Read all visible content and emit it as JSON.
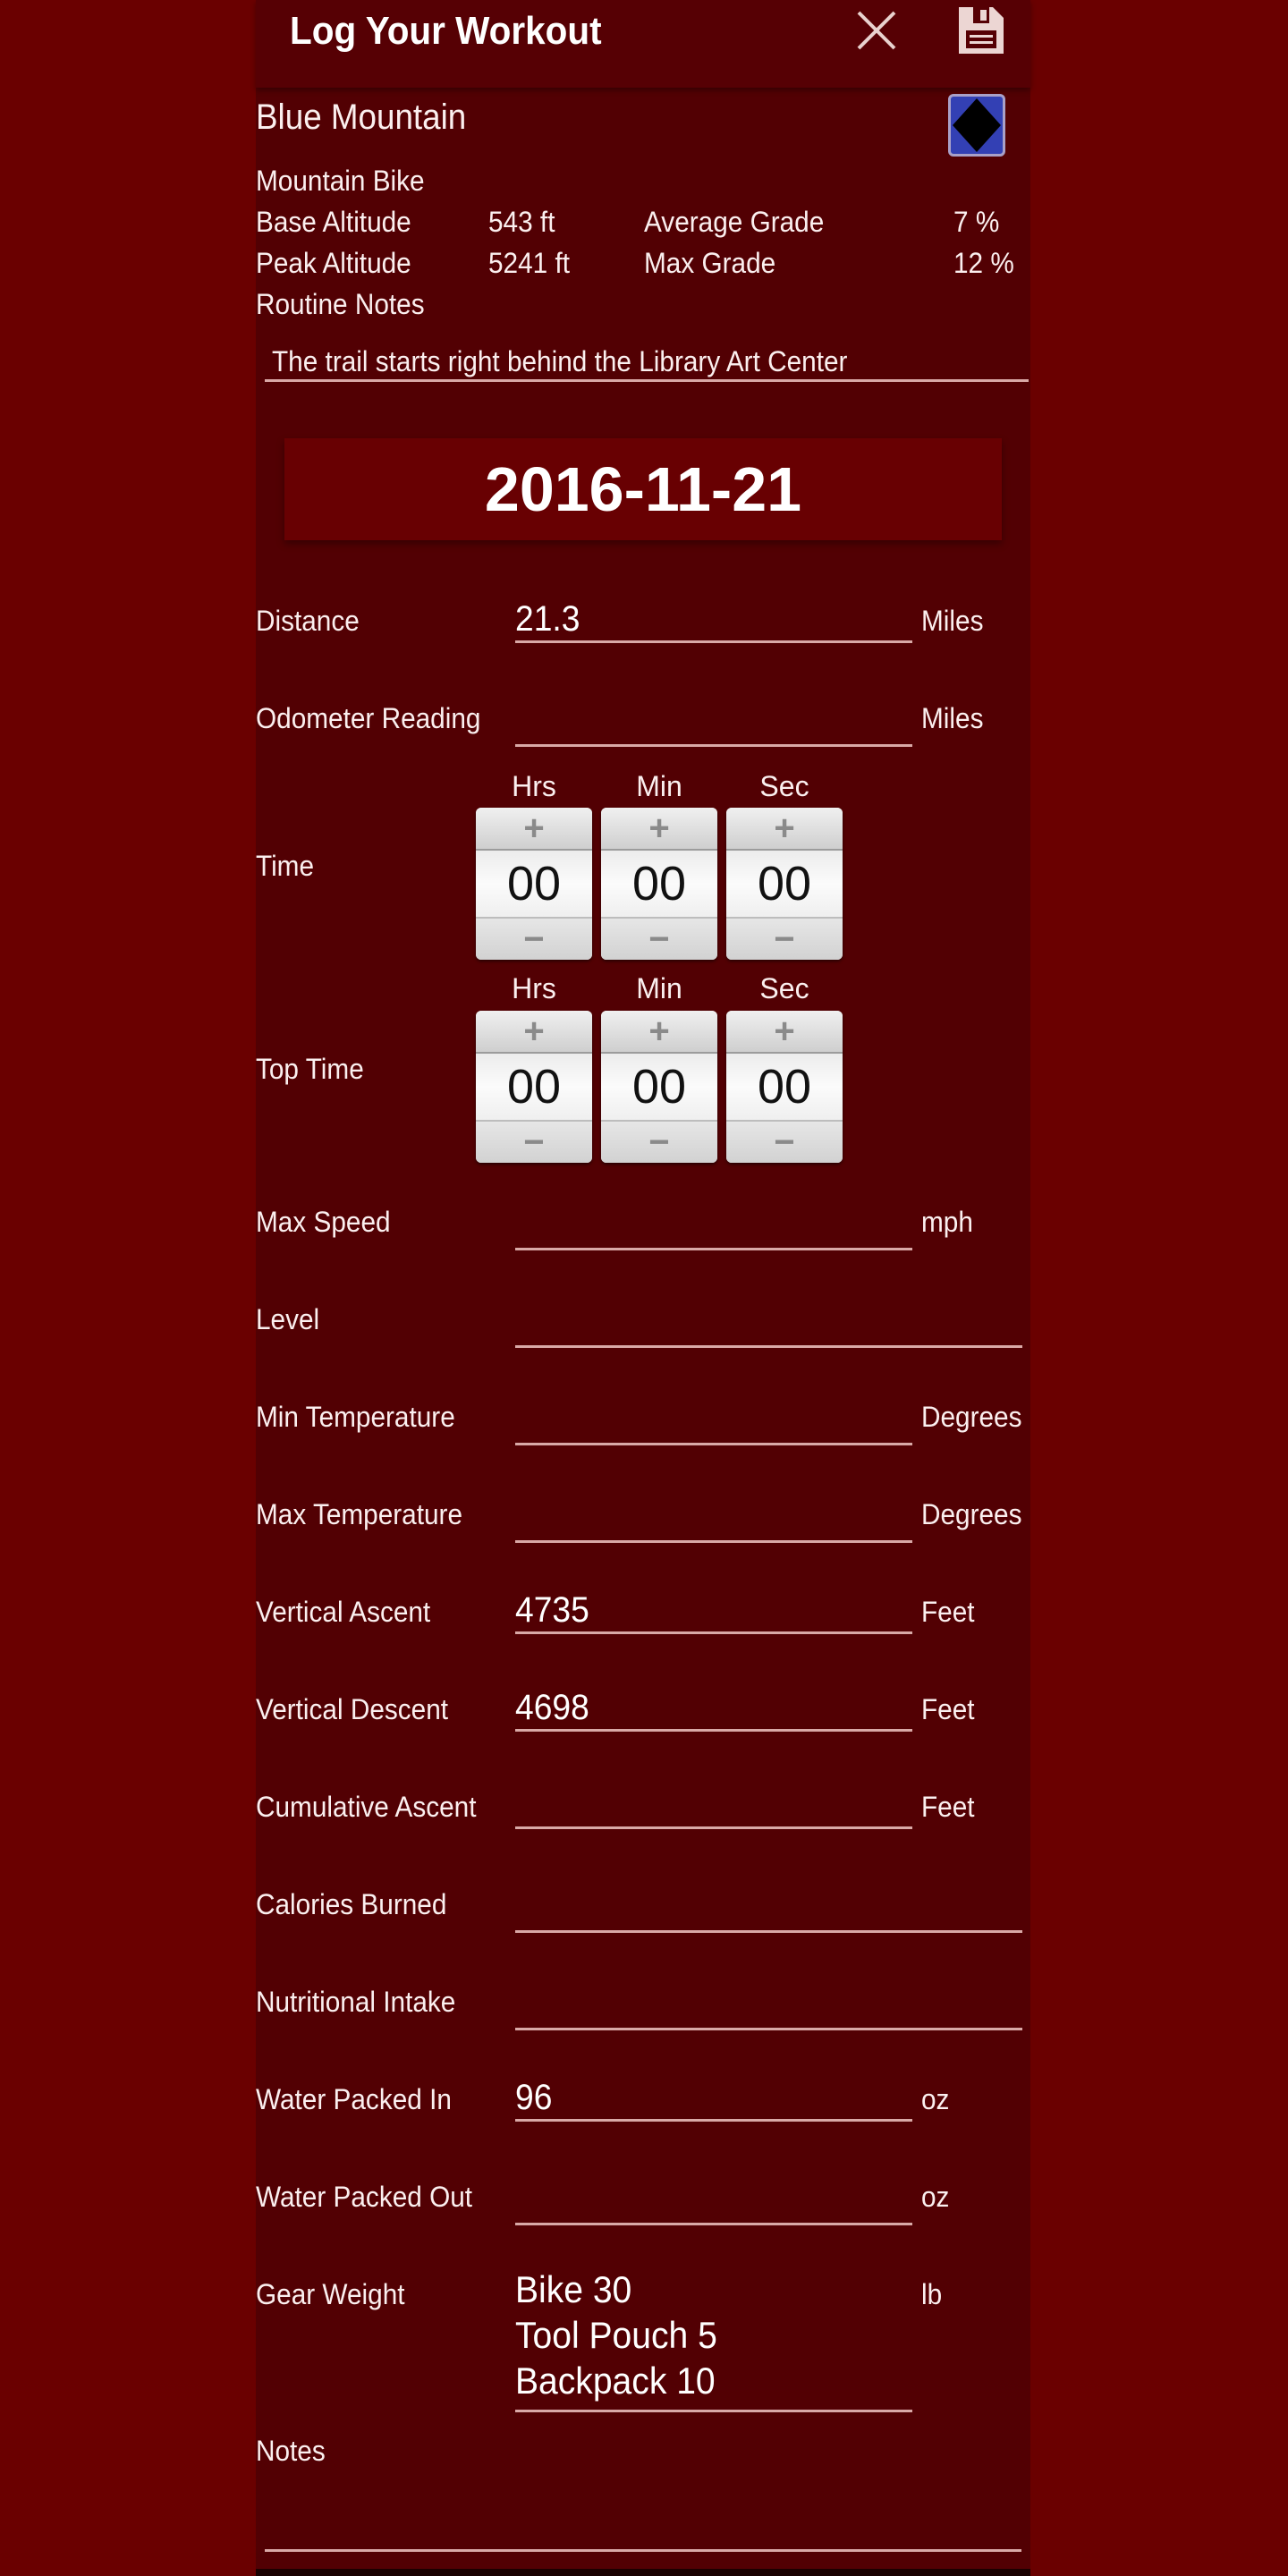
{
  "header": {
    "title": "Log Your Workout",
    "close_icon": "close-icon",
    "save_icon": "save-floppy-icon"
  },
  "route": {
    "name": "Blue Mountain",
    "difficulty_icon": "black-diamond-difficulty-icon",
    "difficulty_colors": {
      "badge": "#3340b4",
      "diamond": "#000000"
    },
    "activity": "Mountain Bike",
    "base_altitude_label": "Base Altitude",
    "base_altitude_value": "543 ft",
    "peak_altitude_label": "Peak Altitude",
    "peak_altitude_value": "5241 ft",
    "average_grade_label": "Average Grade",
    "average_grade_value": "7 %",
    "max_grade_label": "Max Grade",
    "max_grade_value": "12 %",
    "routine_notes_label": "Routine Notes",
    "routine_notes_value": "The trail starts right behind the Library Art Center"
  },
  "date": "2016-11-21",
  "fields": {
    "distance": {
      "label": "Distance",
      "value": "21.3",
      "unit": "Miles"
    },
    "odometer": {
      "label": "Odometer Reading",
      "value": "",
      "unit": "Miles"
    },
    "max_speed": {
      "label": "Max Speed",
      "value": "",
      "unit": "mph"
    },
    "level": {
      "label": "Level",
      "value": ""
    },
    "min_temperature": {
      "label": "Min Temperature",
      "value": "",
      "unit": "Degrees"
    },
    "max_temperature": {
      "label": "Max Temperature",
      "value": "",
      "unit": "Degrees"
    },
    "vertical_ascent": {
      "label": "Vertical Ascent",
      "value": "4735",
      "unit": "Feet"
    },
    "vertical_descent": {
      "label": "Vertical Descent",
      "value": "4698",
      "unit": "Feet"
    },
    "cumulative_ascent": {
      "label": "Cumulative Ascent",
      "value": "",
      "unit": "Feet"
    },
    "calories_burned": {
      "label": "Calories Burned",
      "value": ""
    },
    "nutritional_intake": {
      "label": "Nutritional Intake",
      "value": ""
    },
    "water_packed_in": {
      "label": "Water Packed In",
      "value": "96",
      "unit": "oz"
    },
    "water_packed_out": {
      "label": "Water Packed Out",
      "value": "",
      "unit": "oz"
    },
    "gear_weight": {
      "label": "Gear Weight",
      "lines": [
        "Bike 30",
        "Tool Pouch 5",
        "Backpack 10"
      ],
      "unit": "lb"
    },
    "notes": {
      "label": "Notes",
      "value": ""
    }
  },
  "time": {
    "label": "Time",
    "columns": [
      "Hrs",
      "Min",
      "Sec"
    ],
    "values": [
      "00",
      "00",
      "00"
    ],
    "plus": "+",
    "minus": "−"
  },
  "top_time": {
    "label": "Top Time",
    "columns": [
      "Hrs",
      "Min",
      "Sec"
    ],
    "values": [
      "00",
      "00",
      "00"
    ],
    "plus": "+",
    "minus": "−"
  }
}
